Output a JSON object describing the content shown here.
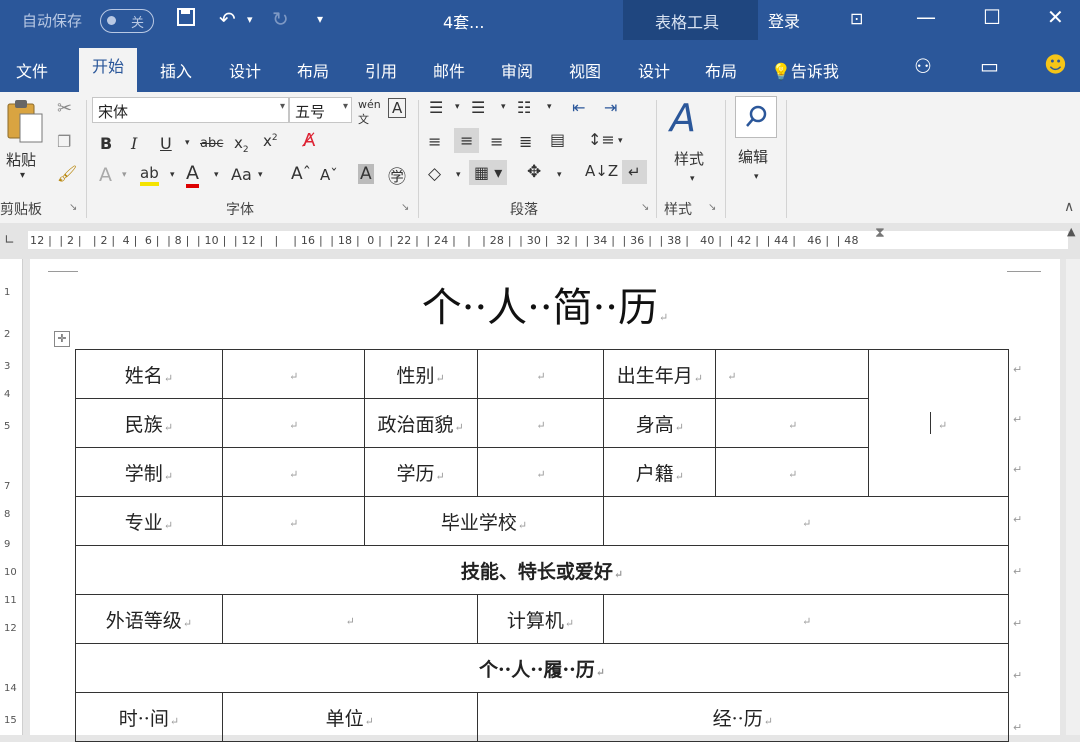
{
  "titlebar": {
    "autosave_label": "自动保存",
    "autosave_state": "关",
    "doc_title": "4套...",
    "table_tools": "表格工具",
    "login": "登录"
  },
  "tabs": [
    "文件",
    "开始",
    "插入",
    "设计",
    "布局",
    "引用",
    "邮件",
    "审阅",
    "视图",
    "设计",
    "布局"
  ],
  "tell_me": "告诉我",
  "ribbon": {
    "paste_label": "粘贴",
    "clipboard_label": "剪贴板",
    "font_name": "宋体",
    "font_size": "五号",
    "font_group_label": "字体",
    "paragraph_group_label": "段落",
    "styles_label": "样式",
    "styles_group_label": "样式",
    "edit_label": "编辑"
  },
  "ruler_text": "12 |  | 2 |   | 2 |  4 |  6 |  | 8 |  | 10 |  | 12 |   |    | 16 |  | 18 |  0 |  | 22 |  | 24 |   |   | 28 |  | 30 |  32 |  | 34 |  | 36 |  | 38 |   40 |  | 42 |  | 44 |   46 |  | 48",
  "vruler_numbers": [
    "1",
    "2",
    "3",
    "4",
    "5",
    "7",
    "8",
    "9",
    "10",
    "11",
    "12",
    "14",
    "15"
  ],
  "document": {
    "heading": "个··人··简··历",
    "rows": {
      "r1": [
        "姓名",
        "",
        "性别",
        "",
        "出生年月",
        ""
      ],
      "r2": [
        "民族",
        "",
        "政治面貌",
        "",
        "身高",
        ""
      ],
      "r3": [
        "学制",
        "",
        "学历",
        "",
        "户籍",
        ""
      ],
      "r4": [
        "专业",
        "",
        "毕业学校",
        ""
      ],
      "section_skills": "技能、特长或爱好",
      "r6": [
        "外语等级",
        "",
        "计算机",
        ""
      ],
      "section_history": "个··人··履··历",
      "r8": [
        "时··间",
        "单位",
        "经··历"
      ]
    },
    "paragraph_mark": "↵",
    "colors": {
      "ribbon_blue": "#2b579a",
      "table_tools_blue": "#1f467f"
    }
  }
}
